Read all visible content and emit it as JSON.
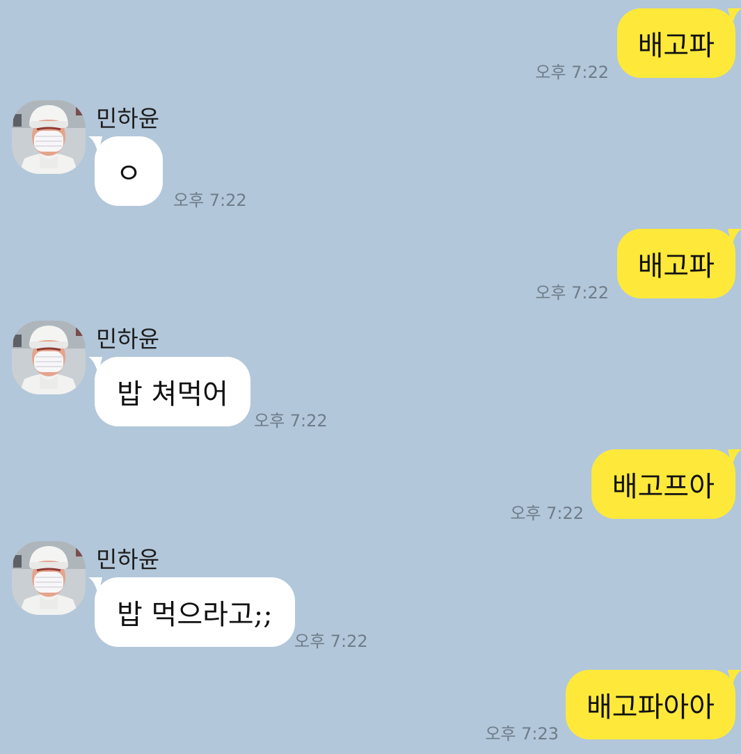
{
  "chat": {
    "background_color": "#b2c7da",
    "my_bubble_color": "#fee93a",
    "their_bubble_color": "#ffffff",
    "messages": [
      {
        "from": "me",
        "text": "배고파",
        "time": "오후 7:22"
      },
      {
        "from": "them",
        "sender": "민하윤",
        "text": "ㅇ",
        "time": "오후 7:22",
        "avatar_icon": "profile-photo-masked-person-icon"
      },
      {
        "from": "me",
        "text": "배고파",
        "time": "오후 7:22"
      },
      {
        "from": "them",
        "sender": "민하윤",
        "text": "밥 쳐먹어",
        "time": "오후 7:22",
        "avatar_icon": "profile-photo-masked-person-icon"
      },
      {
        "from": "me",
        "text": "배고프아",
        "time": "오후 7:22"
      },
      {
        "from": "them",
        "sender": "민하윤",
        "text": "밥 먹으라고;;",
        "time": "오후 7:22",
        "avatar_icon": "profile-photo-masked-person-icon"
      },
      {
        "from": "me",
        "text": "배고파아아",
        "time": "오후 7:23"
      }
    ]
  }
}
